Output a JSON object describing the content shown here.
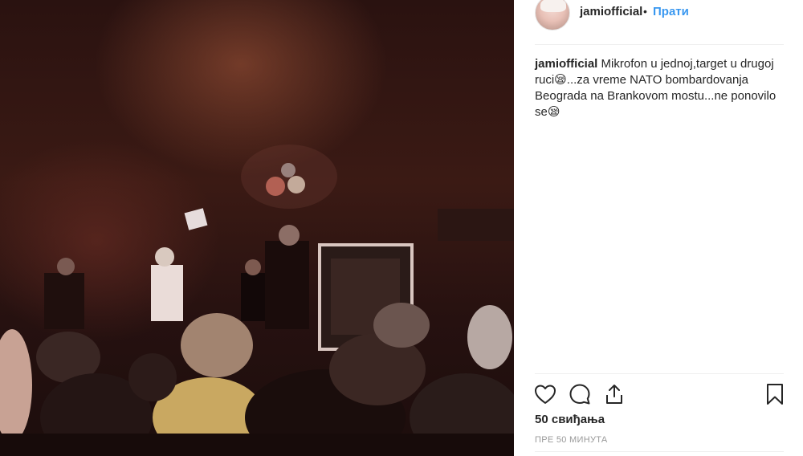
{
  "post": {
    "username": "jamiofficial",
    "separator": "•",
    "follow_label": "Прати",
    "caption": {
      "username": "jamiofficial",
      "text": "Mikrofon u jednoj,target u drugoj ruci😪...za vreme NATO bombardovanja Beograda na Brankovom mostu...ne ponovilo se😪"
    },
    "likes_text": "50 свиђања",
    "time_text": "ПРЕ 50 МИНУТА"
  },
  "icons": {
    "like": "heart-icon",
    "comment": "comment-icon",
    "share": "share-icon",
    "save": "bookmark-icon"
  },
  "colors": {
    "link_blue": "#3897f0",
    "text": "#262626",
    "muted": "#999999"
  }
}
